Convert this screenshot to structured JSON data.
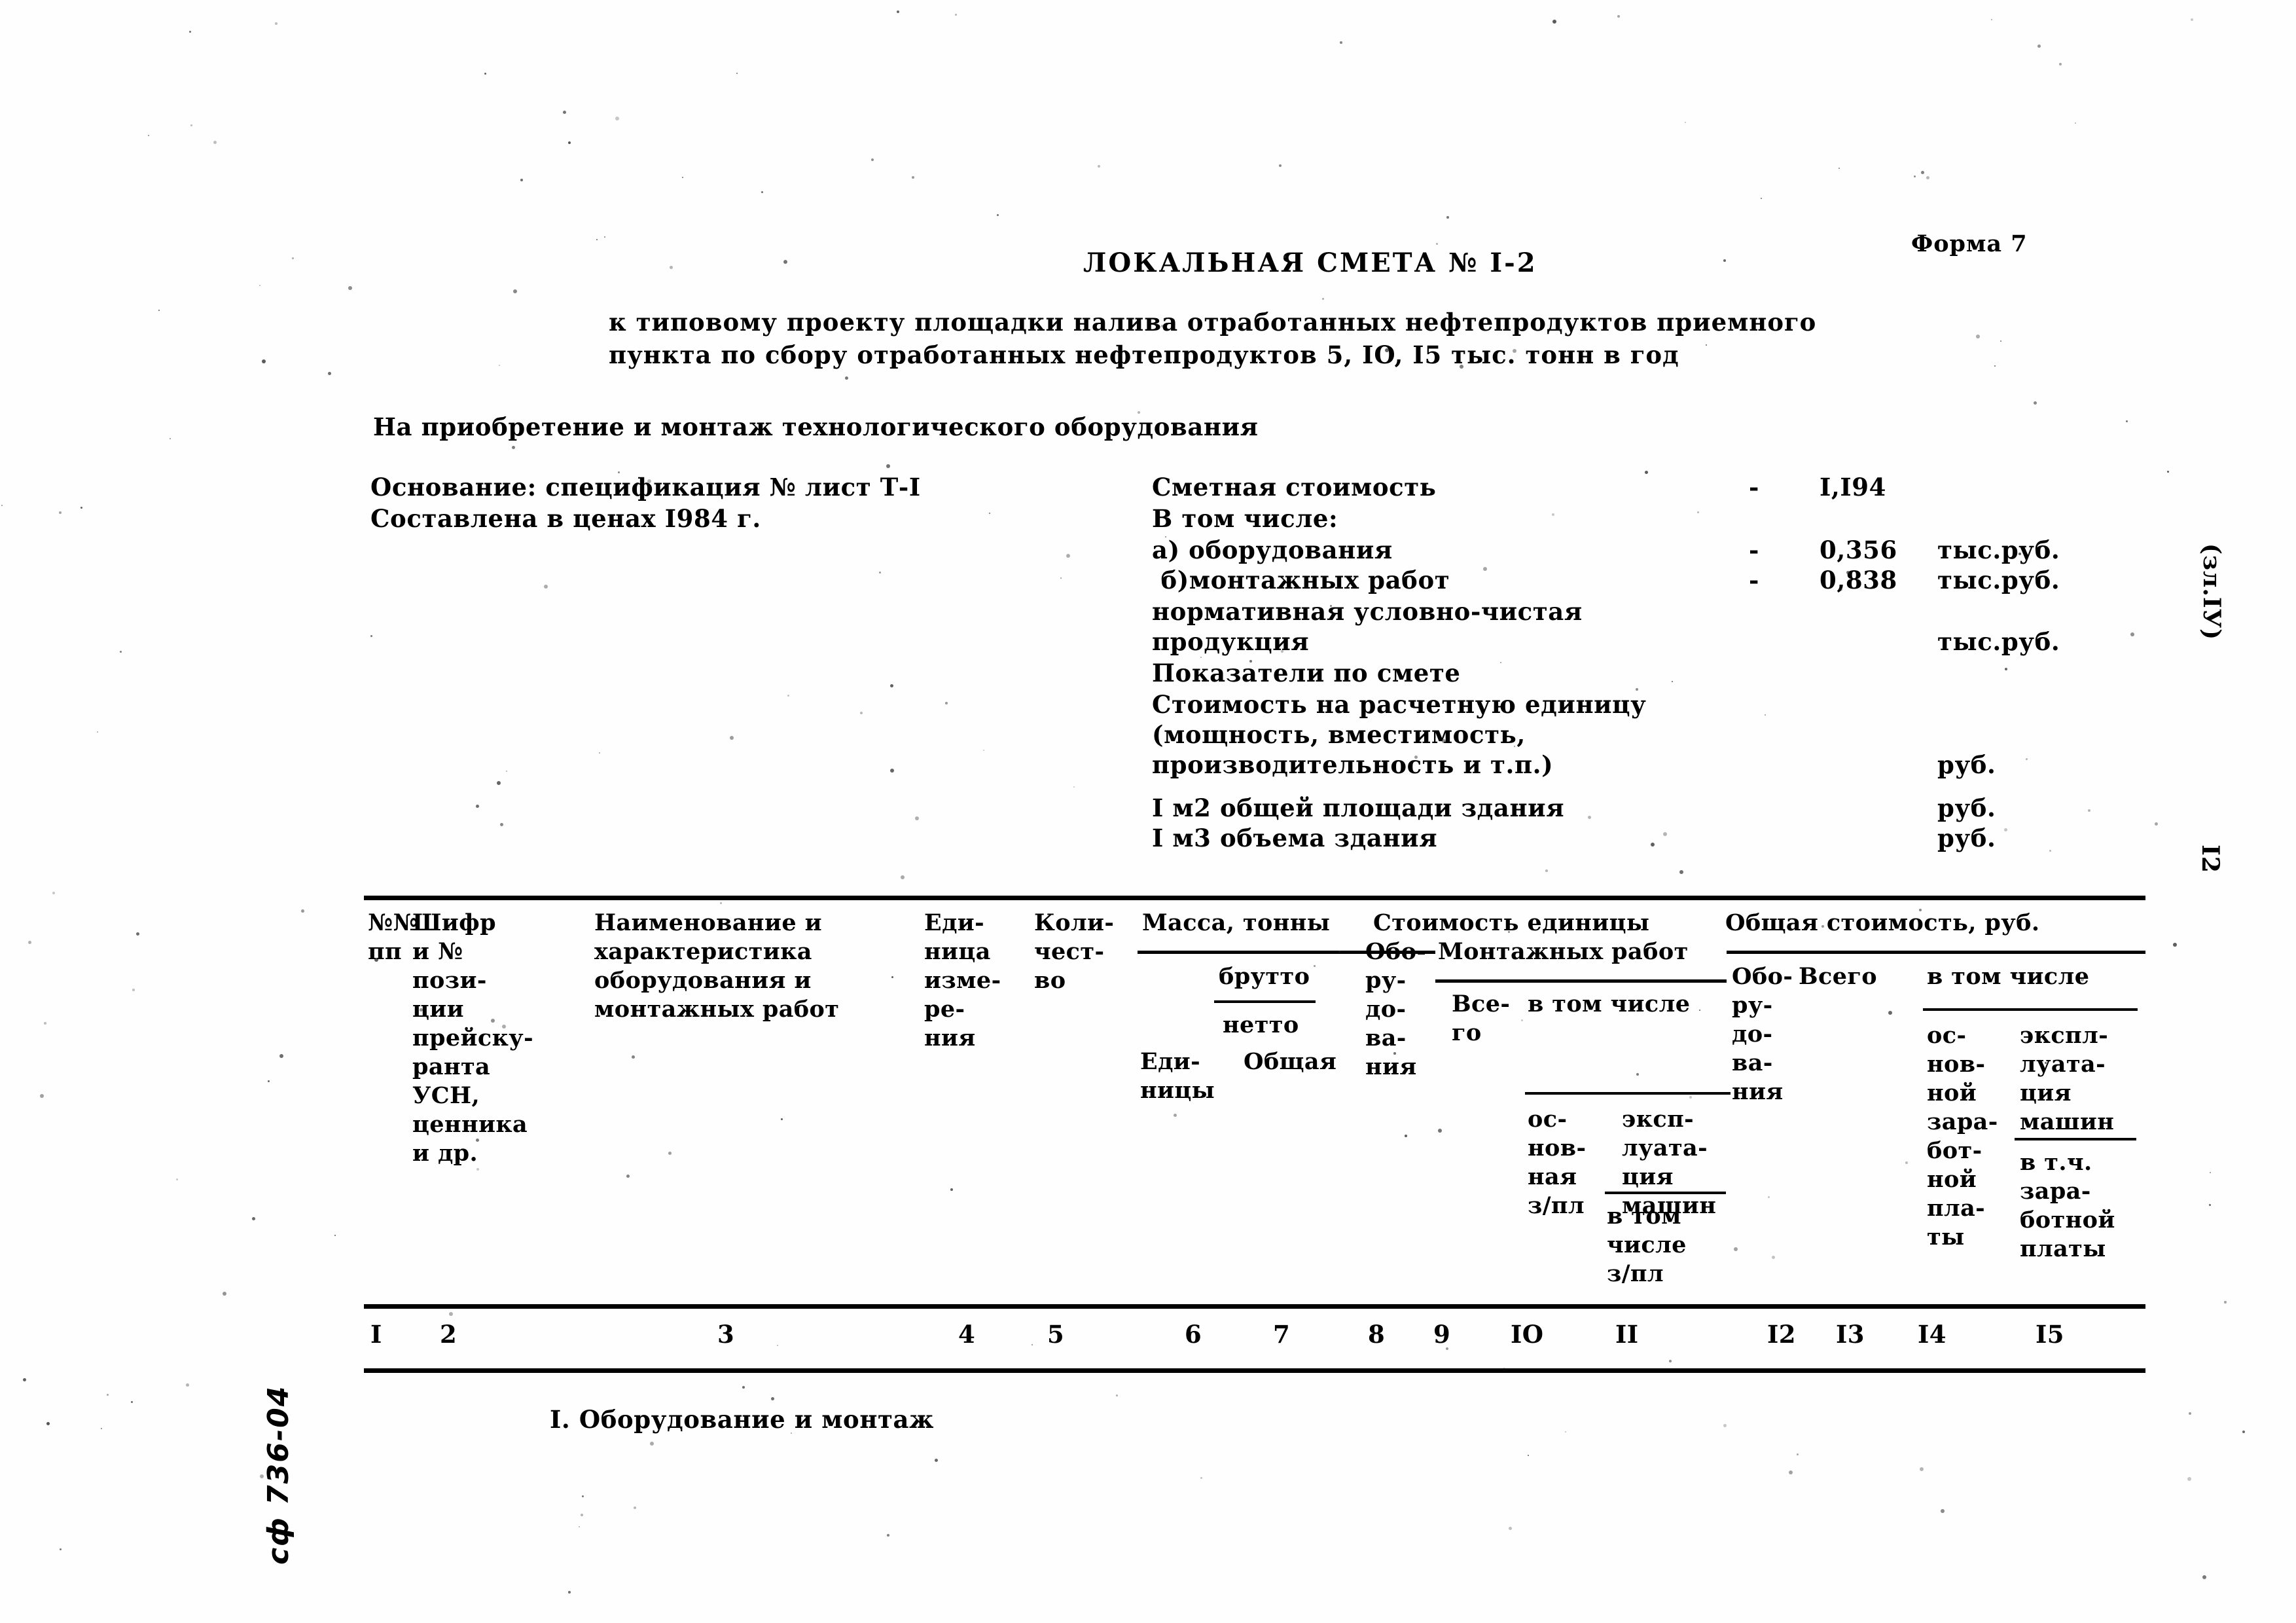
{
  "page": {
    "form_label": "Форма 7",
    "page_number": "I2",
    "volume_note": "(зл.IУ)",
    "archive_stamp": "сф 736-04"
  },
  "header": {
    "title": "ЛОКАЛЬНАЯ СМЕТА № I-2",
    "subtitle_line1": "к типовому проекту площадки налива отработанных нефтепродуктов приемного",
    "subtitle_line2": "пункта по сбору отработанных нефтепродуктов 5, IO, I5 тыс. тонн в год",
    "purpose": "На приобретение и монтаж технологического оборудования"
  },
  "basis": {
    "line1": "Основание: спецификация № лист Т-I",
    "line2": "Составлена в ценах I984 г."
  },
  "summary": {
    "rows": [
      {
        "label": "Сметная стоимость",
        "dash": "-",
        "value": "I,I94",
        "unit": ""
      },
      {
        "label": "В том числе:",
        "dash": "",
        "value": "",
        "unit": ""
      },
      {
        "label": "а) оборудования",
        "dash": "-",
        "value": "0,356",
        "unit": "тыс.руб."
      },
      {
        "label": " б)монтажных работ",
        "dash": "-",
        "value": "0,838",
        "unit": "тыс.руб."
      },
      {
        "label": "нормативная условно-чистая",
        "dash": "",
        "value": "",
        "unit": ""
      },
      {
        "label": "продукция",
        "dash": "",
        "value": "",
        "unit": "тыс.руб."
      },
      {
        "label": "Показатели по смете",
        "dash": "",
        "value": "",
        "unit": ""
      },
      {
        "label": "Стоимость на расчетную единицу",
        "dash": "",
        "value": "",
        "unit": ""
      },
      {
        "label": "(мощность, вместимость,",
        "dash": "",
        "value": "",
        "unit": ""
      },
      {
        "label": "производительность и т.п.)",
        "dash": "",
        "value": "",
        "unit": "руб."
      },
      {
        "label": "I м2 общей площади здания",
        "dash": "",
        "value": "",
        "unit": "руб."
      },
      {
        "label": "I м3 объема здания",
        "dash": "",
        "value": "",
        "unit": "руб."
      }
    ]
  },
  "table": {
    "headers": {
      "c1_line1": "№№",
      "c1_line2": "пп",
      "c2": "Шифр\nи №\nпози-\nции\nпрейску-\nранта\nУСН,\nценника\nи др.",
      "c3": "Наименование и\nхарактеристика\nоборудования и\nмонтажных работ",
      "c4": "Еди-\nница\nизме-\nре-\nния",
      "c5": "Коли-\nчест-\nво",
      "mass_group": "Масса, тонны",
      "mass_brutto": "брутто",
      "mass_netto": "нетто",
      "c6": "Еди-\nницы",
      "c7": "Общая",
      "unitcost_group": "Стоимость единицы",
      "c8": "Обо-\nру-\nдо-\nва-\nния",
      "montazh_group": "Монтажных работ",
      "c9": "Все-\nго",
      "vtomchisle_1": "в том числе",
      "c10": "ос-\nнов-\nная\nз/пл",
      "c11_a": "эксп-\nлуата-\nция\nмашин",
      "c11_b": "в том\nчисле\nз/пл",
      "totalcost_group": "Общая стоимость, руб.",
      "c12": "Обо-\nру-\nдо-\nва-\nния",
      "c13": "Всего",
      "vtomchisle_2": "в том числе",
      "c14": "ос-\nнов-\nной\nзара-\nбот-\nной\nпла-\nты",
      "c15_a": "экспл-\nлуата-\nция\nмашин",
      "c15_b": "в т.ч.\nзара-\nботной\nплаты"
    },
    "column_numbers": [
      "I",
      "2",
      "3",
      "4",
      "5",
      "6",
      "7",
      "8",
      "9",
      "IO",
      "II",
      "I2",
      "I3",
      "I4",
      "I5"
    ],
    "section_heading": "I. Оборудование и монтаж"
  }
}
